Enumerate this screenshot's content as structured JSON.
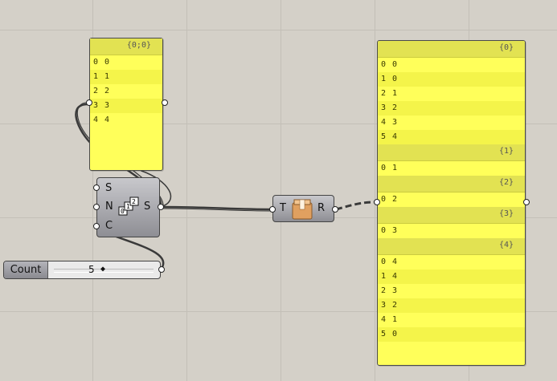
{
  "left_panel": {
    "header": "{0;0}",
    "rows": [
      {
        "index": "0",
        "value": "0"
      },
      {
        "index": "1",
        "value": "1"
      },
      {
        "index": "2",
        "value": "2"
      },
      {
        "index": "3",
        "value": "3"
      },
      {
        "index": "4",
        "value": "4"
      }
    ]
  },
  "series_component": {
    "inputs": [
      "S",
      "N",
      "C"
    ],
    "output": "S",
    "icon": "series-icon"
  },
  "slider": {
    "label": "Count",
    "value": "5",
    "knob": "◆"
  },
  "flatten_component": {
    "input": "T",
    "output": "R",
    "icon": "box-icon"
  },
  "right_panel": {
    "branches": [
      {
        "path": "{0}",
        "rows": [
          {
            "index": "0",
            "value": "0"
          },
          {
            "index": "1",
            "value": "0"
          },
          {
            "index": "2",
            "value": "1"
          },
          {
            "index": "3",
            "value": "2"
          },
          {
            "index": "4",
            "value": "3"
          },
          {
            "index": "5",
            "value": "4"
          }
        ]
      },
      {
        "path": "{1}",
        "rows": [
          {
            "index": "0",
            "value": "1"
          }
        ]
      },
      {
        "path": "{2}",
        "rows": [
          {
            "index": "0",
            "value": "2"
          }
        ]
      },
      {
        "path": "{3}",
        "rows": [
          {
            "index": "0",
            "value": "3"
          }
        ]
      },
      {
        "path": "{4}",
        "rows": [
          {
            "index": "0",
            "value": "4"
          },
          {
            "index": "1",
            "value": "4"
          },
          {
            "index": "2",
            "value": "3"
          },
          {
            "index": "3",
            "value": "2"
          },
          {
            "index": "4",
            "value": "1"
          },
          {
            "index": "5",
            "value": "0"
          }
        ]
      }
    ]
  }
}
